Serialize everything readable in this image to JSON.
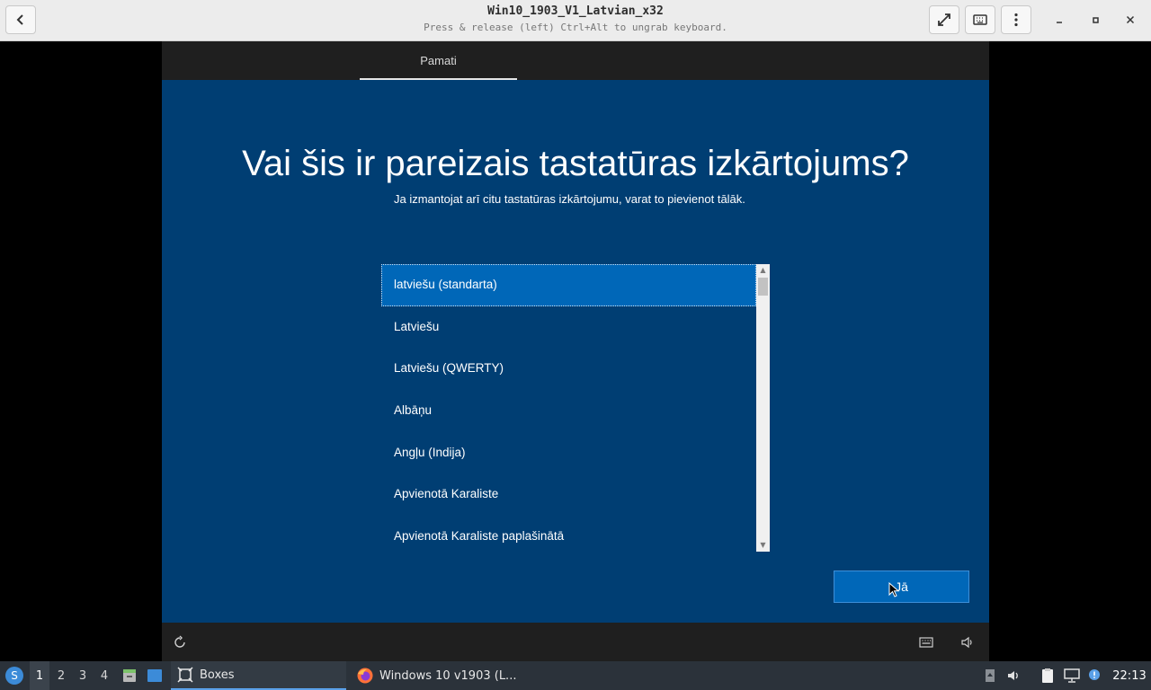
{
  "titlebar": {
    "title": "Win10_1903_V1_Latvian_x32",
    "subtitle": "Press & release (left) Ctrl+Alt to ungrab keyboard.",
    "back_icon": "chevron-left-icon",
    "fullscreen_icon": "expand-icon",
    "keyboard_icon": "keyboard-icon",
    "menu_icon": "vertical-dots-icon"
  },
  "oobe": {
    "tab_label": "Pamati",
    "heading": "Vai šis ir pareizais tastatūras izkārtojums?",
    "subtitle": "Ja izmantojat arī citu tastatūras izkārtojumu, varat to pievienot tālāk.",
    "layouts": [
      "latviešu (standarta)",
      "Latviešu",
      "Latviešu (QWERTY)",
      "Albāņu",
      "Angļu (Indija)",
      "Apvienotā Karaliste",
      "Apvienotā Karaliste paplašinātā"
    ],
    "selected_index": 0,
    "yes_button": "Jā",
    "accent_color": "#0067b8",
    "background_color": "#003e73"
  },
  "taskbar": {
    "workspaces": [
      "1",
      "2",
      "3",
      "4"
    ],
    "active_workspace": "1",
    "task_boxes": "Boxes",
    "task_firefox": "Windows 10 v1903 (L...",
    "clock": "22:13"
  }
}
